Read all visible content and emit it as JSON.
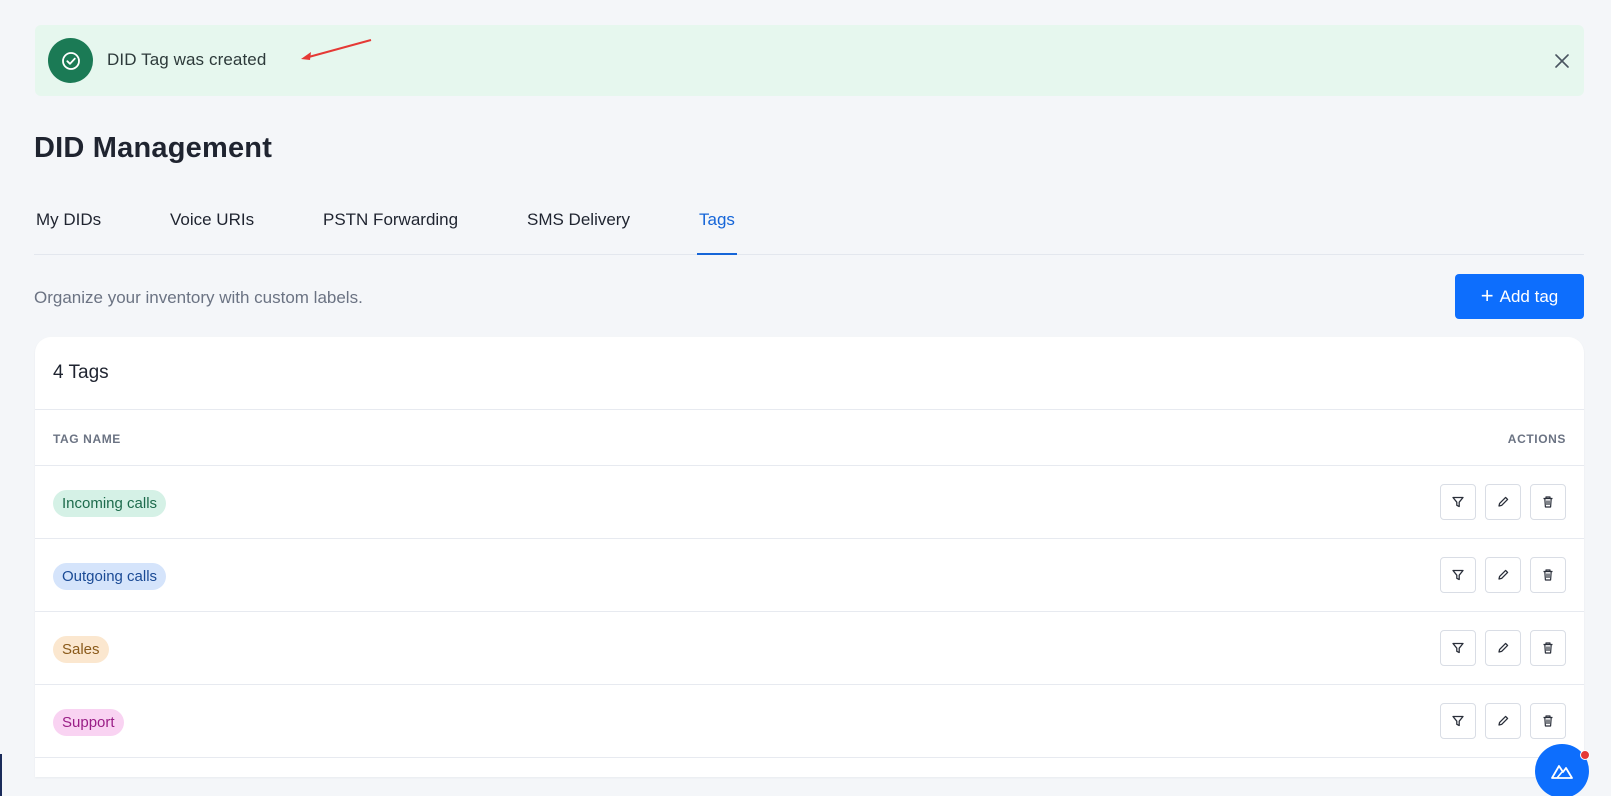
{
  "toast": {
    "message": "DID Tag was created",
    "icon": "check-circle-icon",
    "close_icon": "close-icon",
    "color": "#1b7a55",
    "background": "#e6f7ee"
  },
  "page": {
    "title": "DID Management",
    "subtitle": "Organize your inventory with custom labels."
  },
  "tabs": [
    {
      "label": "My DIDs",
      "active": false
    },
    {
      "label": "Voice URIs",
      "active": false
    },
    {
      "label": "PSTN Forwarding",
      "active": false
    },
    {
      "label": "SMS Delivery",
      "active": false
    },
    {
      "label": "Tags",
      "active": true
    }
  ],
  "add_button": {
    "label": "Add tag",
    "icon": "plus-icon",
    "color": "#0d6efd"
  },
  "table": {
    "count_label": "4 Tags",
    "columns": {
      "name": "TAG NAME",
      "actions": "ACTIONS"
    },
    "rows": [
      {
        "name": "Incoming calls",
        "bg": "#d5f1e6",
        "fg": "#1d6b4c"
      },
      {
        "name": "Outgoing calls",
        "bg": "#d5e4fb",
        "fg": "#1a4a95"
      },
      {
        "name": "Sales",
        "bg": "#fbe7cf",
        "fg": "#8a5a1a"
      },
      {
        "name": "Support",
        "bg": "#f9d3f2",
        "fg": "#9a1e86"
      }
    ],
    "row_actions": [
      "filter-icon",
      "pencil-icon",
      "trash-icon"
    ]
  },
  "fab": {
    "icon": "chat-support-icon",
    "badge_color": "#e53935"
  }
}
